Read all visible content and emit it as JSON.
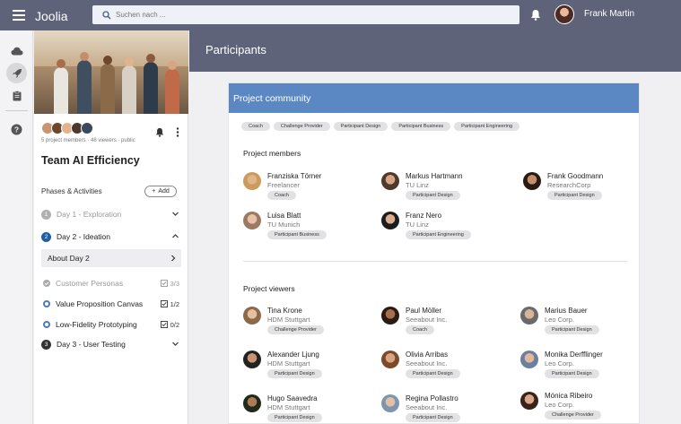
{
  "app": {
    "brand": "Joolia",
    "search_placeholder": "Suchen nach ...",
    "user_name": "Frank Martin"
  },
  "rail": {
    "icons": [
      "cloud-icon",
      "rocket-icon",
      "clipboard-icon",
      "help-icon"
    ]
  },
  "project": {
    "stats": "5 project members · 48 viewers · public",
    "title": "Team AI Efficiency",
    "phases_label": "Phases & Activities",
    "add_label": "Add",
    "phases": [
      {
        "num": "1",
        "label": "Day 1 - Exploration",
        "color": "#b0b0b0",
        "text_color": "#999",
        "state": "collapsed"
      },
      {
        "num": "2",
        "label": "Day 2 - Ideation",
        "color": "#1f5fa8",
        "text_color": "#222",
        "state": "expanded"
      },
      {
        "num": "3",
        "label": "Day 3 - User Testing",
        "color": "#333333",
        "text_color": "#222",
        "state": "collapsed"
      }
    ],
    "about_label": "About Day 2",
    "activities": [
      {
        "label": "Customer Personas",
        "count": "3/3",
        "done": true
      },
      {
        "label": "Value Proposition Canvas",
        "count": "1/2",
        "done": false
      },
      {
        "label": "Low-Fidelity Prototyping",
        "count": "0/2",
        "done": false
      }
    ]
  },
  "main": {
    "title": "Participants",
    "card_title": "Project community",
    "filters": [
      "Coach",
      "Challenge Provider",
      "Participant Design",
      "Participant Business",
      "Participant Engineering"
    ],
    "members_title": "Project members",
    "members": [
      {
        "name": "Franziska Törner",
        "org": "Freelancer",
        "role": "Coach",
        "skin": "#e2b48e",
        "hair": "#c99b5d"
      },
      {
        "name": "Markus Hartmann",
        "org": "TU Linz",
        "role": "Participant Design",
        "skin": "#d8a584",
        "hair": "#4d3a2c"
      },
      {
        "name": "Frank Goodmann",
        "org": "ResearchCorp",
        "role": "Participant Design",
        "skin": "#c48d6c",
        "hair": "#2a1a14"
      },
      {
        "name": "Luisa Blatt",
        "org": "TU Munich",
        "role": "Participant Business",
        "skin": "#e8c2a8",
        "hair": "#9a7a62"
      },
      {
        "name": "Franz Nero",
        "org": "TU Linz",
        "role": "Participant Engineering",
        "skin": "#d9ad8d",
        "hair": "#1c1c1c"
      }
    ],
    "viewers_title": "Project viewers",
    "viewers": [
      {
        "name": "Tina Krone",
        "org": "HDM Stuttgart",
        "role": "Challenge Provider",
        "skin": "#e6bfa0",
        "hair": "#8a6a4a"
      },
      {
        "name": "Paul Möller",
        "org": "Seeabout Inc.",
        "role": "Coach",
        "skin": "#a86e4c",
        "hair": "#2a1a12"
      },
      {
        "name": "Marius Bauer",
        "org": "Leo Corp.",
        "role": "Participant Design",
        "skin": "#d7b39a",
        "hair": "#6a6a6a"
      },
      {
        "name": "Alexander Ljung",
        "org": "HDM Stuttgart",
        "role": "Participant Design",
        "skin": "#c89474",
        "hair": "#222222"
      },
      {
        "name": "Olivia Arribas",
        "org": "Seeabout Inc.",
        "role": "Participant Design",
        "skin": "#d9a582",
        "hair": "#7a4a2a"
      },
      {
        "name": "Monika Derfflinger",
        "org": "Leo Corp.",
        "role": "Participant Design",
        "skin": "#e1b89a",
        "hair": "#6b7fa0"
      },
      {
        "name": "Hugo Saavedra",
        "org": "HDM Stuttgart",
        "role": "Participant Design",
        "skin": "#b07a55",
        "hair": "#1e2a1a"
      },
      {
        "name": "Regina Pollastro",
        "org": "Seeabout Inc.",
        "role": "Participant Design",
        "skin": "#e2bfa6",
        "hair": "#7d96b0"
      },
      {
        "name": "Mónica Ribeiro",
        "org": "Leo Corp.",
        "role": "Challenge Provider",
        "skin": "#d8a88c",
        "hair": "#3a2418"
      }
    ]
  },
  "colors": {
    "topbar": "#5f6379",
    "card_header": "#5b88c2",
    "accent": "#1f5fa8"
  }
}
